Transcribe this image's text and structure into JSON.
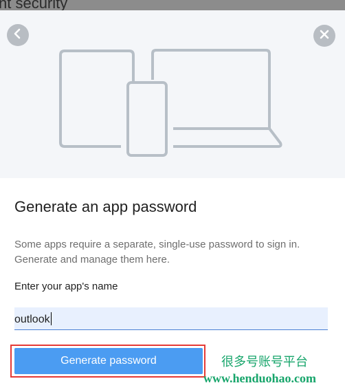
{
  "backdrop": {
    "text": "nt security"
  },
  "hero": {
    "back_icon": "chevron-left-icon",
    "close_icon": "close-icon",
    "illustration_icon": "devices-icon"
  },
  "dialog": {
    "title": "Generate an app password",
    "description": "Some apps require a separate, single-use password to sign in. Generate and manage them here.",
    "field_label": "Enter your app's name",
    "field_value": "outlook",
    "button_label": "Generate password"
  },
  "watermark": {
    "chinese": "很多号账号平台",
    "url": "www.henduohao.com"
  },
  "colors": {
    "accent": "#4b9cf2",
    "highlight": "#e53935",
    "watermark": "#17a56b",
    "icon_gray": "#b8bdc3"
  }
}
